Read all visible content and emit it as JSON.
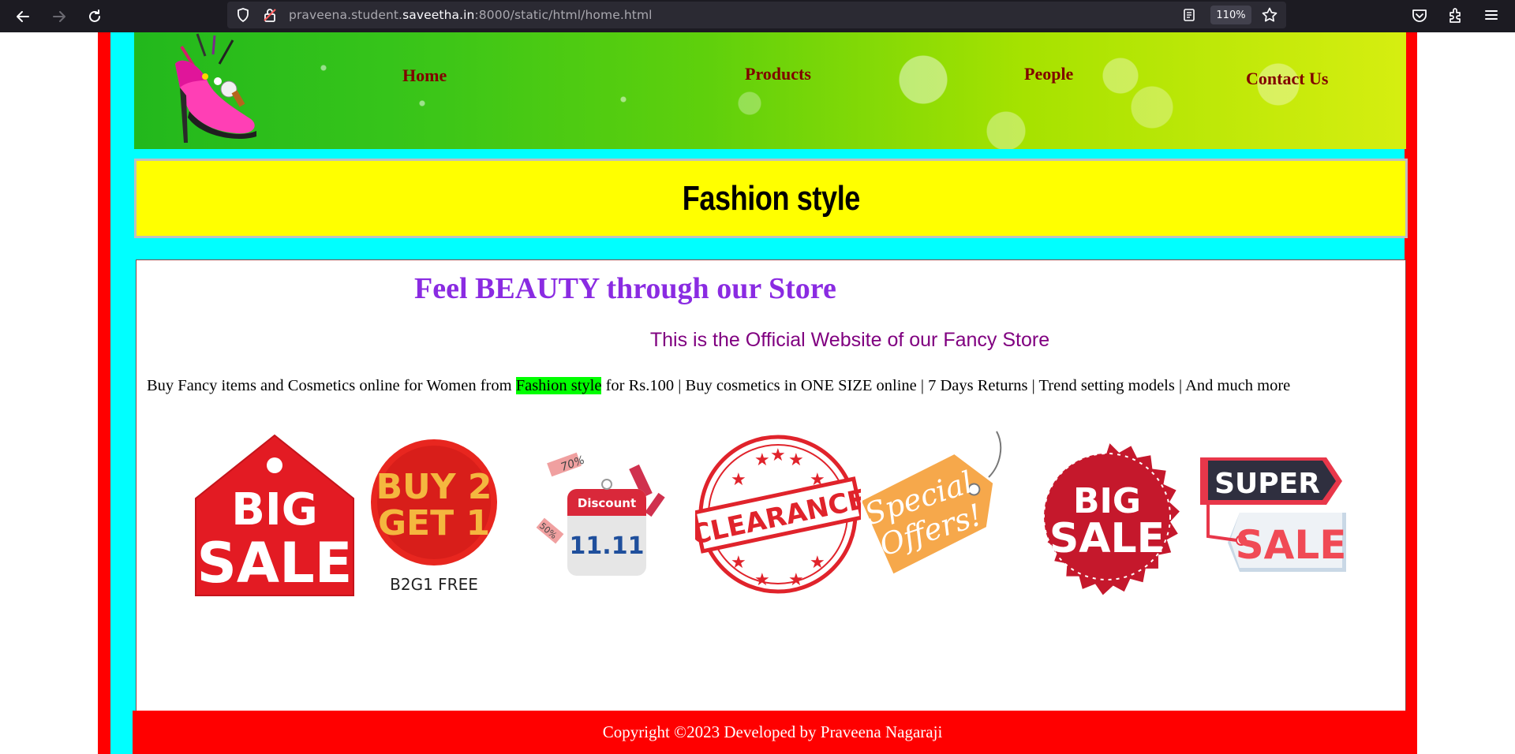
{
  "browser": {
    "url_prefix": "praveena.student.",
    "url_host": "saveetha.in",
    "url_suffix": ":8000/static/html/home.html",
    "zoom": "110%"
  },
  "header": {
    "nav": [
      {
        "label": "Home"
      },
      {
        "label": "Products"
      },
      {
        "label": "People"
      },
      {
        "label": "Contact Us"
      }
    ]
  },
  "banner": {
    "title": "Fashion style"
  },
  "content": {
    "tagline": "Feel BEAUTY through our Store",
    "subtitle": "This is the Official Website of our Fancy Store",
    "description_before": "Buy Fancy items and Cosmetics online for Women from ",
    "description_highlight": "Fashion style",
    "description_after": " for Rs.100 | Buy cosmetics in ONE SIZE online | 7 Days Returns | Trend setting models | And much more",
    "badges": {
      "big_sale_1": {
        "line1": "BIG",
        "line2": "SALE"
      },
      "buy2get1": {
        "line1": "BUY 2",
        "line2": "GET 1",
        "caption": "B2G1 FREE"
      },
      "discount": {
        "title": "Discount",
        "date": "11.11",
        "tag1": "70%",
        "tag2": "50%"
      },
      "clearance": {
        "label": "CLEARANCE"
      },
      "special": {
        "line1": "Special",
        "line2": "Offers!"
      },
      "big_sale_2": {
        "line1": "BIG",
        "line2": "SALE"
      },
      "super_sale": {
        "line1": "SUPER",
        "line2": "SALE"
      }
    }
  },
  "footer": {
    "text": "Copyright ©2023 Developed by Praveena Nagaraji"
  },
  "colors": {
    "page_border": "#ff0000",
    "page_bg": "#00ffff",
    "banner_bg": "#ffff00",
    "nav_text": "#800000",
    "tagline": "#8a2be2",
    "subtitle": "#800080",
    "highlight": "#00ff00",
    "footer_bg": "#ff0000"
  }
}
